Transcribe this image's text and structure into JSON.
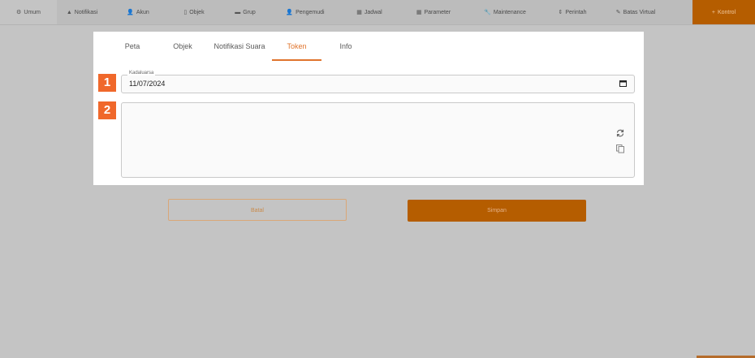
{
  "topnav": {
    "items": [
      {
        "icon": "⚙",
        "label": "Umum"
      },
      {
        "icon": "▲",
        "label": "Notifikasi"
      },
      {
        "icon": "👤",
        "label": "Akun"
      },
      {
        "icon": "▯",
        "label": "Objek"
      },
      {
        "icon": "▬",
        "label": "Grup"
      },
      {
        "icon": "👤",
        "label": "Pengemudi"
      },
      {
        "icon": "▦",
        "label": "Jadwal"
      },
      {
        "icon": "▦",
        "label": "Parameter"
      },
      {
        "icon": "🔧",
        "label": "Maintenance"
      },
      {
        "icon": "⇕",
        "label": "Perintah"
      },
      {
        "icon": "✎",
        "label": "Batas Virtual"
      }
    ],
    "primary": {
      "icon": "+",
      "label": "Kontrol"
    }
  },
  "tabs": [
    {
      "label": "Peta"
    },
    {
      "label": "Objek"
    },
    {
      "label": "Notifikasi Suara"
    },
    {
      "label": "Token"
    },
    {
      "label": "Info"
    }
  ],
  "badges": {
    "one": "1",
    "two": "2"
  },
  "expiry": {
    "label": "Kadaluarsa",
    "value": "11/07/2024"
  },
  "token": {
    "value": ""
  },
  "buttons": {
    "back": "Batal",
    "save": "Simpan"
  },
  "colors": {
    "accent": "#e0742c",
    "primary": "#b55d00",
    "badge": "#f0682b"
  }
}
